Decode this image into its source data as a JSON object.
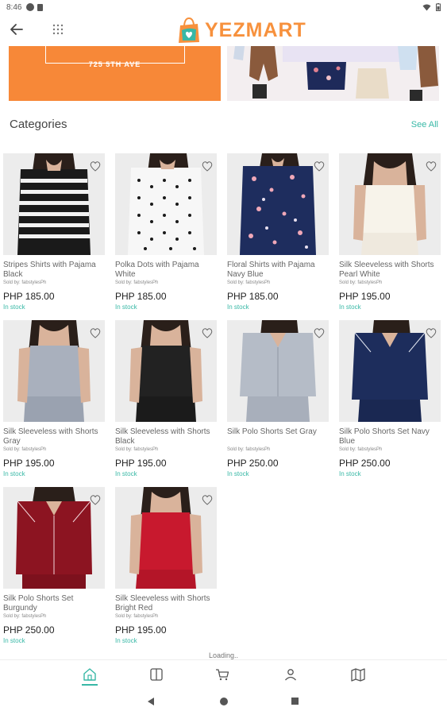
{
  "status_bar": {
    "time": "8:46"
  },
  "app_bar": {
    "logo_text": "YEZMART"
  },
  "banners": {
    "orange_address": "725 5TH AVE"
  },
  "categories": {
    "title": "Categories",
    "see_all": "See All"
  },
  "colors": {
    "accent": "#38b8a6",
    "brand_orange": "#f7913d"
  },
  "products": [
    {
      "name": "Stripes Shirts with Pajama Black",
      "seller": "Sold by: fabstylesPh",
      "price": "PHP 185.00",
      "stock": "In stock"
    },
    {
      "name": "Polka Dots with Pajama White",
      "seller": "Sold by: fabstylesPh",
      "price": "PHP 185.00",
      "stock": "In stock"
    },
    {
      "name": "Floral Shirts with Pajama Navy Blue",
      "seller": "Sold by: fabstylesPh",
      "price": "PHP 185.00",
      "stock": "In stock"
    },
    {
      "name": "Silk Sleeveless with Shorts Pearl White",
      "seller": "Sold by: fabstylesPh",
      "price": "PHP 195.00",
      "stock": "In stock"
    },
    {
      "name": "Silk Sleeveless with Shorts Gray",
      "seller": "Sold by: fabstylesPh",
      "price": "PHP 195.00",
      "stock": "In stock"
    },
    {
      "name": "Silk Sleeveless with Shorts Black",
      "seller": "Sold by: fabstylesPh",
      "price": "PHP 195.00",
      "stock": "In stock"
    },
    {
      "name": "Silk Polo Shorts Set Gray",
      "seller": "Sold by: fabstylesPh",
      "price": "PHP 250.00",
      "stock": "In stock"
    },
    {
      "name": "Silk Polo Shorts Set Navy Blue",
      "seller": "Sold by: fabstylesPh",
      "price": "PHP 250.00",
      "stock": "In stock"
    },
    {
      "name": "Silk Polo Shorts Set Burgundy",
      "seller": "Sold by: fabstylesPh",
      "price": "PHP 250.00",
      "stock": "In stock"
    },
    {
      "name": "Silk Sleeveless with Shorts Bright Red",
      "seller": "Sold by: fabstylesPh",
      "price": "PHP 195.00",
      "stock": "In stock"
    }
  ],
  "loading_text": "Loading..",
  "bottom_nav": [
    {
      "icon": "home-icon",
      "active": true
    },
    {
      "icon": "catalog-icon",
      "active": false
    },
    {
      "icon": "cart-icon",
      "active": false
    },
    {
      "icon": "account-icon",
      "active": false
    },
    {
      "icon": "map-icon",
      "active": false
    }
  ]
}
